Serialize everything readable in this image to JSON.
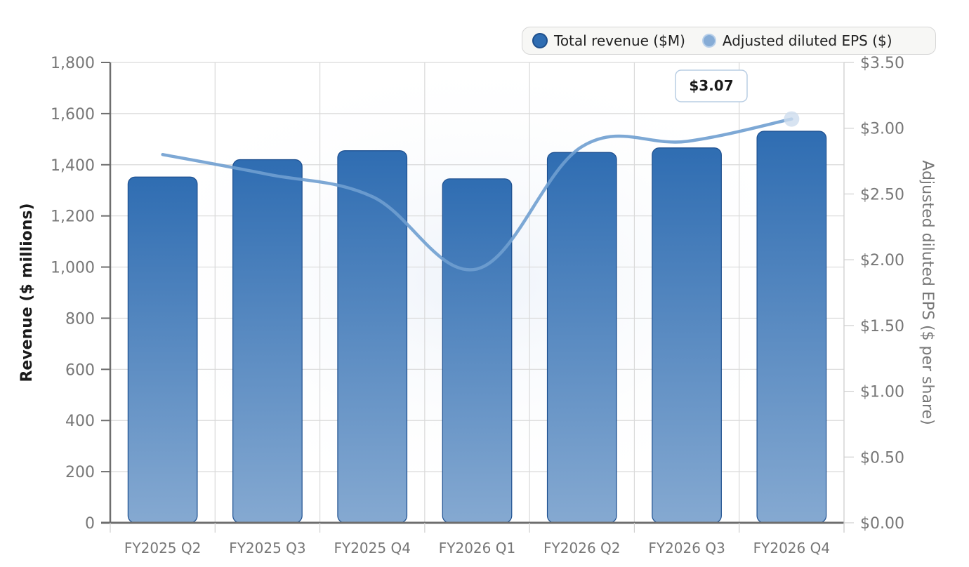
{
  "chart_data": {
    "type": "bar",
    "categories": [
      "FY2025 Q2",
      "FY2025 Q3",
      "FY2025 Q4",
      "FY2026 Q1",
      "FY2026 Q2",
      "FY2026 Q3",
      "FY2026 Q4"
    ],
    "series": [
      {
        "name": "Total revenue ($M)",
        "type": "bar",
        "axis": "left",
        "values": [
          1352,
          1420,
          1455,
          1345,
          1448,
          1466,
          1531
        ]
      },
      {
        "name": "Adjusted diluted EPS ($)",
        "type": "line",
        "axis": "right",
        "values": [
          2.8,
          2.65,
          2.48,
          1.93,
          2.86,
          2.9,
          3.07
        ]
      }
    ],
    "ylabel": "Revenue ($ millions)",
    "y2label": "Adjusted diluted EPS ($ per share)",
    "ylim": [
      0,
      1800
    ],
    "y2lim": [
      0,
      3.5
    ],
    "yticks": [
      "0",
      "200",
      "400",
      "600",
      "800",
      "1,000",
      "1,200",
      "1,400",
      "1,600",
      "1,800"
    ],
    "y2ticks": [
      "$0.00",
      "$0.50",
      "$1.00",
      "$1.50",
      "$2.00",
      "$2.50",
      "$3.00",
      "$3.50"
    ],
    "annotation": "$3.07",
    "grid": true,
    "legend_position": "top-right",
    "colors": {
      "bar": "#2f6db2",
      "bar_light": "#85a9d1",
      "line": "#6f9fd0",
      "axis": "#6e6e6e",
      "grid": "#d9d9d9"
    }
  }
}
